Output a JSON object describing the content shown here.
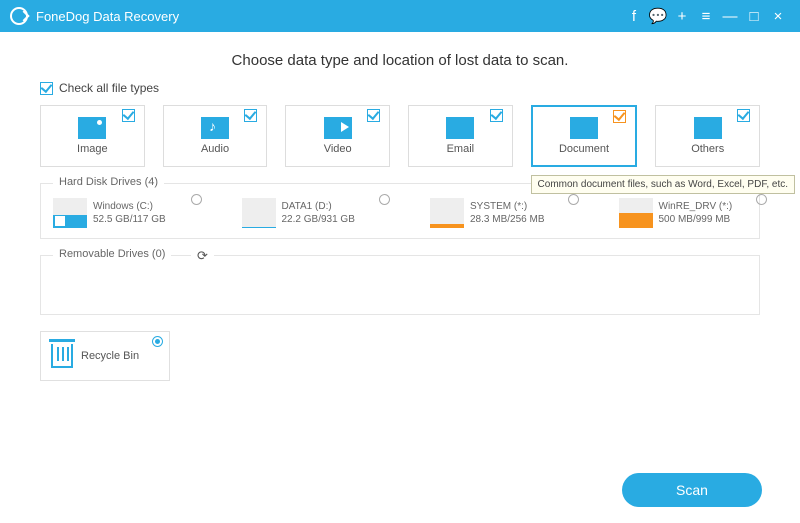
{
  "app": {
    "title": "FoneDog Data Recovery"
  },
  "heading": "Choose data type and location of lost data to scan.",
  "checkAll": {
    "label": "Check all file types",
    "checked": true
  },
  "types": [
    {
      "id": "image",
      "label": "Image",
      "checked": true,
      "selected": false
    },
    {
      "id": "audio",
      "label": "Audio",
      "checked": true,
      "selected": false
    },
    {
      "id": "video",
      "label": "Video",
      "checked": true,
      "selected": false
    },
    {
      "id": "email",
      "label": "Email",
      "checked": true,
      "selected": false
    },
    {
      "id": "document",
      "label": "Document",
      "checked": true,
      "selected": true,
      "orange": true
    },
    {
      "id": "others",
      "label": "Others",
      "checked": true,
      "selected": false
    }
  ],
  "tooltip": "Common document files, such as Word, Excel, PDF, etc.",
  "hardDisk": {
    "title": "Hard Disk Drives (4)",
    "drives": [
      {
        "name": "Windows (C:)",
        "size": "52.5 GB/117 GB",
        "fill": 45,
        "color": "blue",
        "winIcon": true
      },
      {
        "name": "DATA1 (D:)",
        "size": "22.2 GB/931 GB",
        "fill": 3,
        "color": "blue"
      },
      {
        "name": "SYSTEM (*:)",
        "size": "28.3 MB/256 MB",
        "fill": 12,
        "color": "orange"
      },
      {
        "name": "WinRE_DRV (*:)",
        "size": "500 MB/999 MB",
        "fill": 50,
        "color": "orange"
      }
    ]
  },
  "removable": {
    "title": "Removable Drives (0)"
  },
  "recycle": {
    "label": "Recycle Bin",
    "selected": true
  },
  "scan": {
    "label": "Scan"
  }
}
